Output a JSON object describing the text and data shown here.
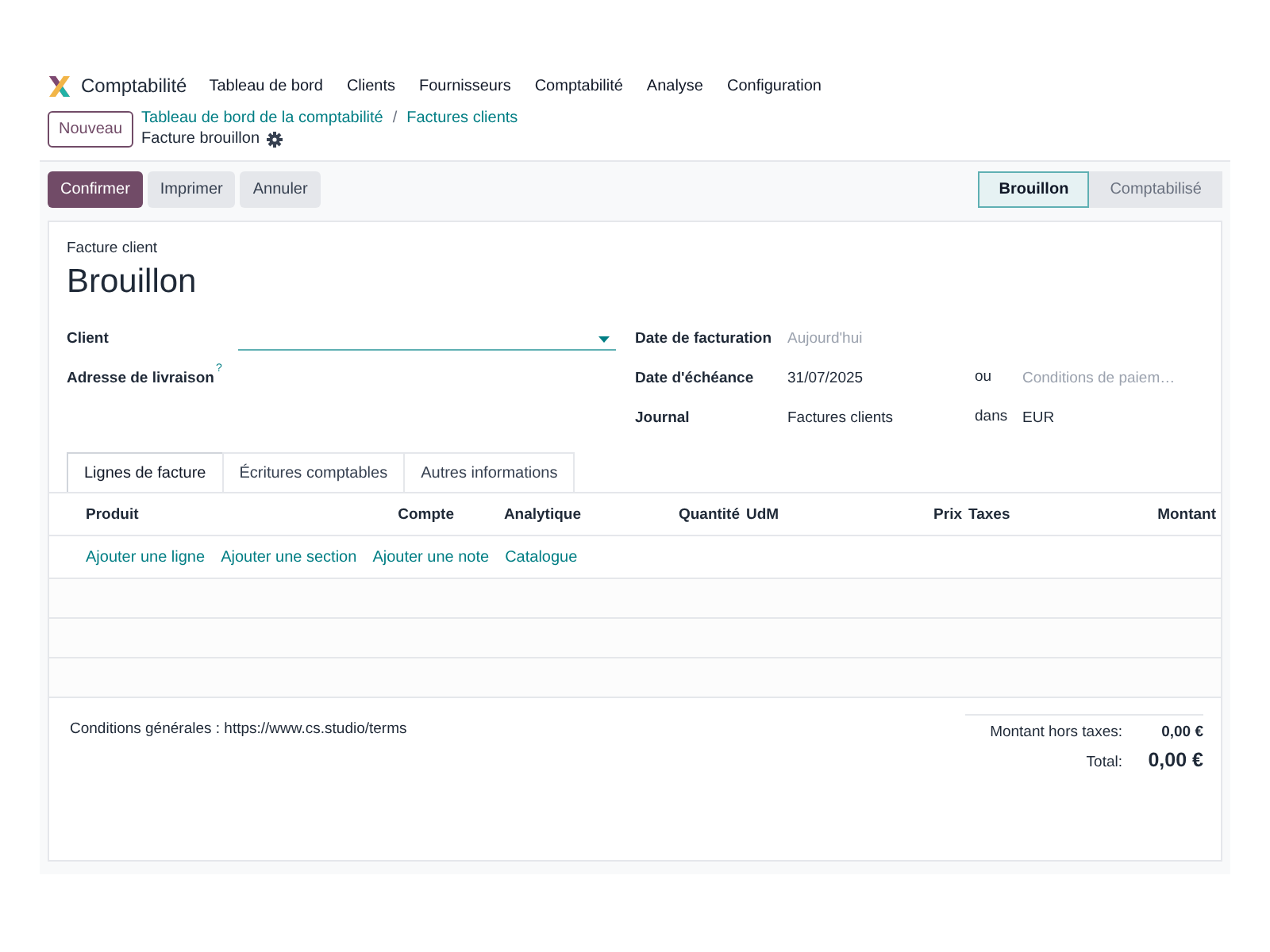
{
  "app": {
    "name": "Comptabilité",
    "menu": [
      "Tableau de bord",
      "Clients",
      "Fournisseurs",
      "Comptabilité",
      "Analyse",
      "Configuration"
    ]
  },
  "control_panel": {
    "new_button": "Nouveau",
    "breadcrumb": [
      "Tableau de bord de la comptabilité",
      "Factures clients"
    ],
    "separator": "/",
    "current": "Facture brouillon"
  },
  "actions": [
    {
      "label": "Confirmer",
      "kind": "primary"
    },
    {
      "label": "Imprimer",
      "kind": "secondary"
    },
    {
      "label": "Annuler",
      "kind": "secondary"
    }
  ],
  "status_steps": [
    {
      "label": "Brouillon",
      "selected": true
    },
    {
      "label": "Comptabilisé",
      "selected": false
    }
  ],
  "form": {
    "type_label": "Facture client",
    "title": "Brouillon",
    "left_fields": [
      {
        "label": "Client",
        "kind": "select"
      },
      {
        "label": "Adresse de livraison",
        "kind": "empty",
        "help": "?"
      }
    ],
    "right_fields": [
      {
        "label": "Date de facturation",
        "placeholder": "Aujourd'hui"
      },
      {
        "label": "Date d'échéance",
        "value": "31/07/2025",
        "connector": "ou",
        "placeholder2": "Conditions de paiem…"
      },
      {
        "label": "Journal",
        "value": "Factures clients",
        "connector": "dans",
        "value2": "EUR"
      }
    ]
  },
  "tabs": [
    {
      "label": "Lignes de facture",
      "selected": true
    },
    {
      "label": "Écritures comptables",
      "selected": false
    },
    {
      "label": "Autres informations",
      "selected": false
    }
  ],
  "columns": [
    "Produit",
    "Compte",
    "Analytique",
    "Quantité",
    "UdM",
    "Prix",
    "Taxes",
    "Montant"
  ],
  "add_links": [
    "Ajouter une ligne",
    "Ajouter une section",
    "Ajouter une note",
    "Catalogue"
  ],
  "terms": "Conditions générales : https://www.cs.studio/terms",
  "totals": [
    {
      "label": "Montant hors taxes:",
      "value": "0,00 €",
      "kind": "subtotal"
    },
    {
      "label": "Total:",
      "value": "0,00 €",
      "kind": "total"
    }
  ]
}
